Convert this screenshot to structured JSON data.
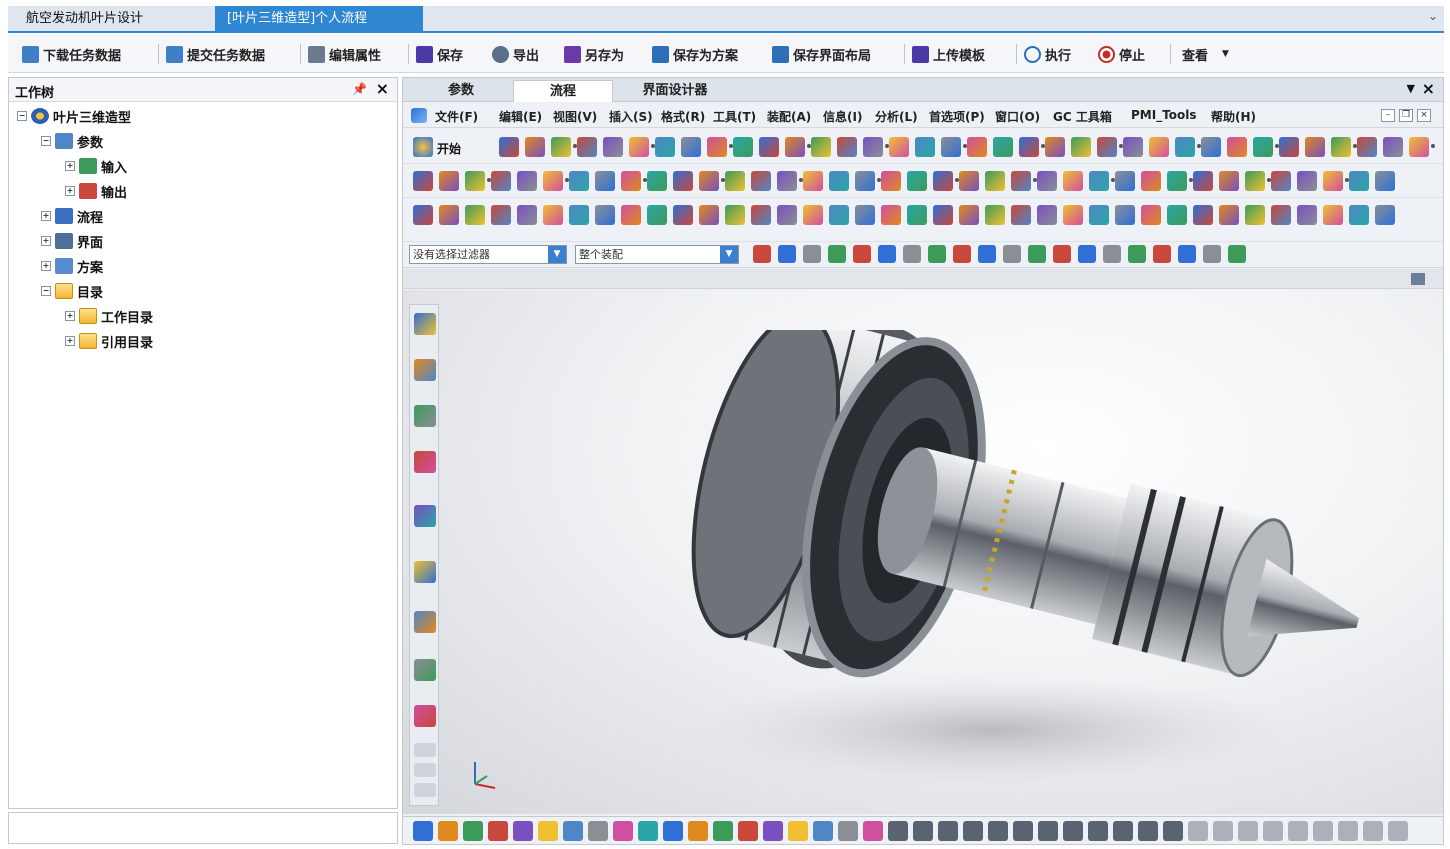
{
  "tabs": {
    "main": "航空发动机叶片设计",
    "active": "[叶片三维造型]个人流程"
  },
  "toolbar": {
    "download": "下载任务数据",
    "submit": "提交任务数据",
    "edit_props": "编辑属性",
    "save": "保存",
    "export": "导出",
    "save_as": "另存为",
    "save_as_plan": "保存为方案",
    "save_layout": "保存界面布局",
    "upload_template": "上传模板",
    "execute": "执行",
    "stop": "停止",
    "view": "查看"
  },
  "tree": {
    "title": "工作树",
    "root": "叶片三维造型",
    "params": "参数",
    "input": "输入",
    "output": "输出",
    "flow": "流程",
    "ui": "界面",
    "plan": "方案",
    "catalog": "目录",
    "work_catalog": "工作目录",
    "ref_catalog": "引用目录"
  },
  "workspace_tabs": {
    "params": "参数",
    "flow": "流程",
    "ui_designer": "界面设计器"
  },
  "menus": {
    "file": "文件(F)",
    "edit": "编辑(E)",
    "view": "视图(V)",
    "insert": "插入(S)",
    "format": "格式(R)",
    "tools": "工具(T)",
    "assembly": "装配(A)",
    "info": "信息(I)",
    "analysis": "分析(L)",
    "preferences": "首选项(P)",
    "window": "窗口(O)",
    "gc_toolkit": "GC 工具箱",
    "pmi_tools": "PMI_Tools",
    "help": "帮助(H)"
  },
  "start_button": "开始",
  "filter": {
    "selection_filter": "没有选择过滤器",
    "scope": "整个装配"
  },
  "colors": {
    "accent": "#2f86d1",
    "tab_strip": "#dfe6ef"
  }
}
